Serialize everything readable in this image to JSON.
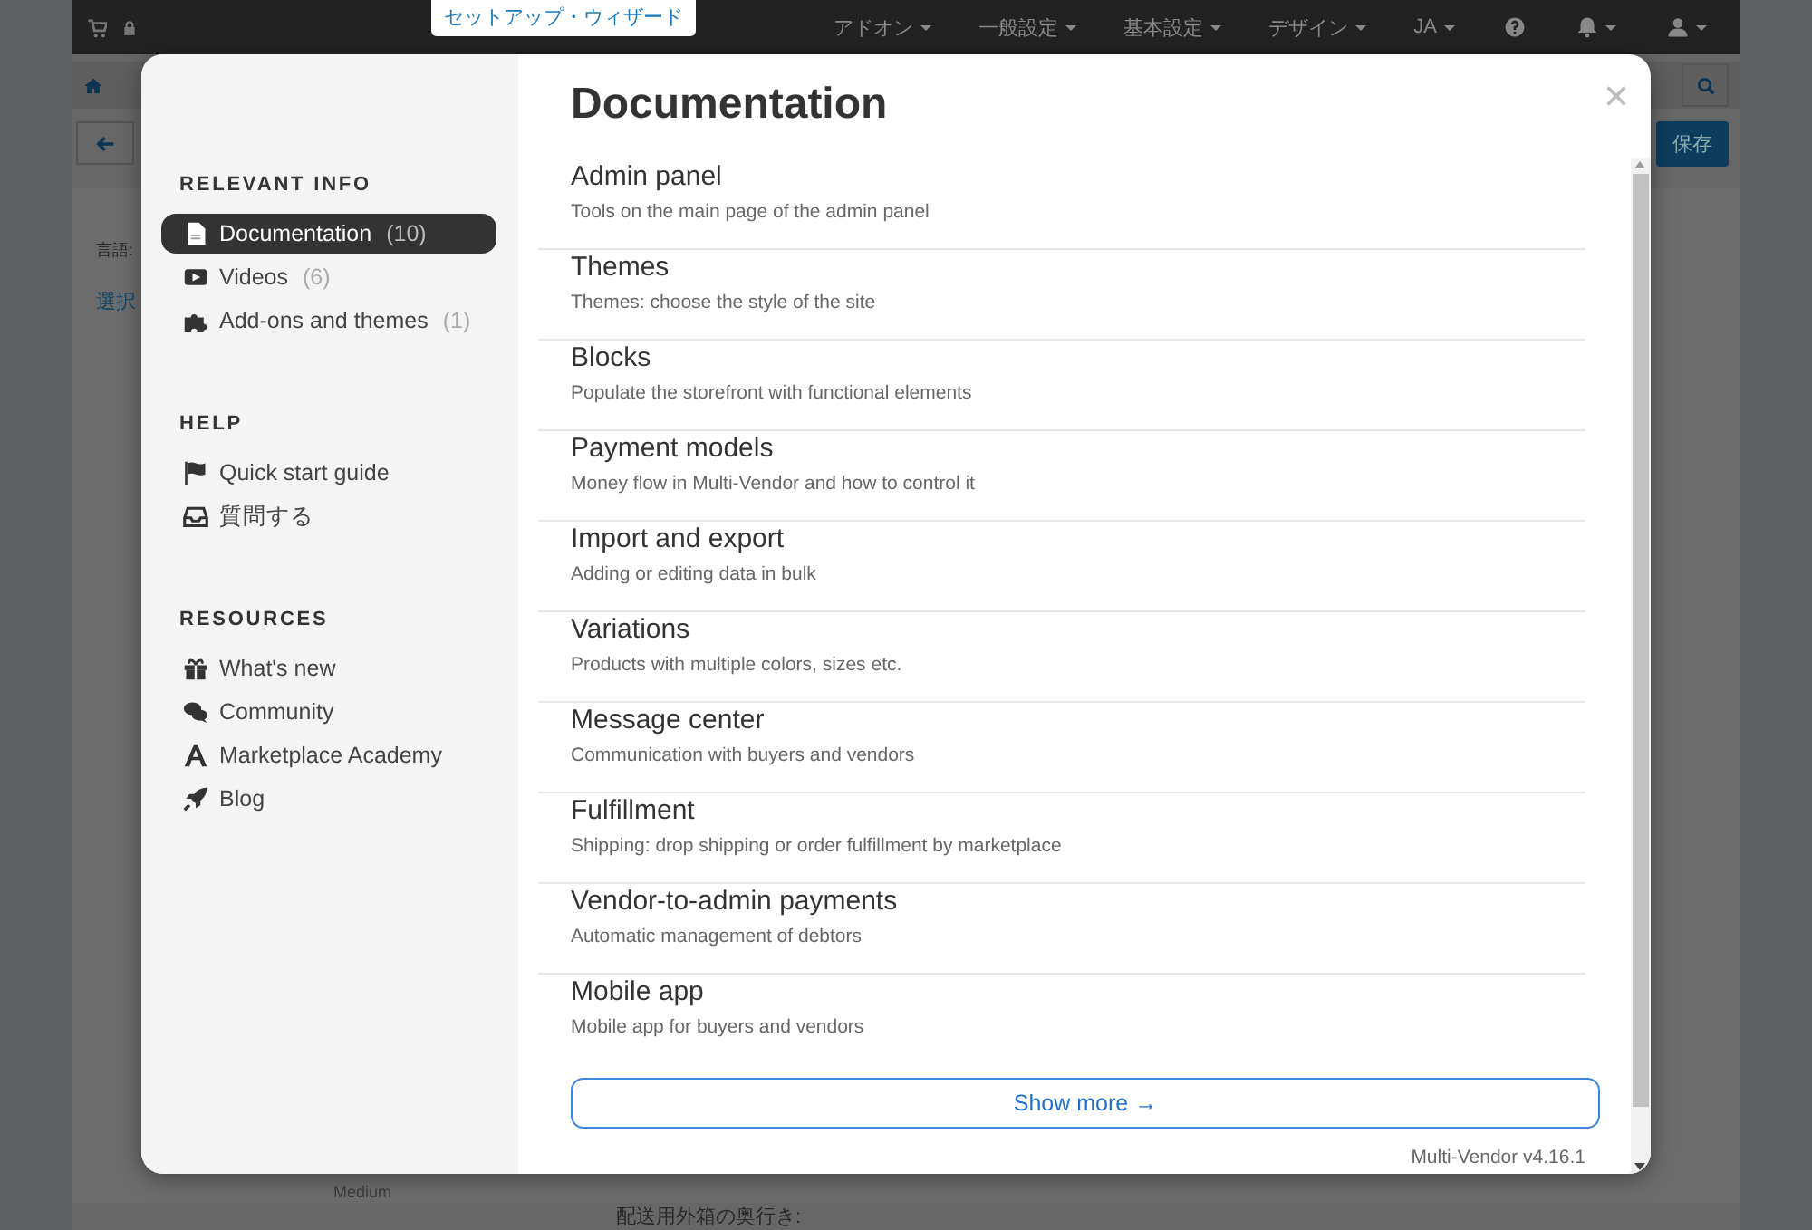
{
  "top_bar": {
    "wizard_link": "セットアップ・ウィザード",
    "menus": [
      {
        "label": "アドオン"
      },
      {
        "label": "一般設定"
      },
      {
        "label": "基本設定"
      },
      {
        "label": "デザイン"
      },
      {
        "label": "JA"
      }
    ]
  },
  "background_page": {
    "save_button": "保存",
    "language_label": "言語:",
    "select_link": "選択",
    "size_text": "Medium",
    "depth_label": "配送用外箱の奥行き:"
  },
  "modal": {
    "close": "×",
    "title": "Documentation",
    "sidebar": [
      {
        "heading": "RELEVANT INFO",
        "items": [
          {
            "label": "Documentation",
            "count": "(10)",
            "selected": true
          },
          {
            "label": "Videos",
            "count": "(6)",
            "selected": false
          },
          {
            "label": "Add-ons and themes",
            "count": "(1)",
            "selected": false
          }
        ]
      },
      {
        "heading": "HELP",
        "items": [
          {
            "label": "Quick start guide",
            "selected": false
          },
          {
            "label": "質問する",
            "selected": false
          }
        ]
      },
      {
        "heading": "RESOURCES",
        "items": [
          {
            "label": "What's new",
            "selected": false
          },
          {
            "label": "Community",
            "selected": false
          },
          {
            "label": "Marketplace Academy",
            "selected": false
          },
          {
            "label": "Blog",
            "selected": false
          }
        ]
      }
    ],
    "articles": [
      {
        "title": "Admin panel",
        "description": "Tools on the main page of the admin panel"
      },
      {
        "title": "Themes",
        "description": "Themes: choose the style of the site"
      },
      {
        "title": "Blocks",
        "description": "Populate the storefront with functional elements"
      },
      {
        "title": "Payment models",
        "description": "Money flow in Multi-Vendor and how to control it"
      },
      {
        "title": "Import and export",
        "description": "Adding or editing data in bulk"
      },
      {
        "title": "Variations",
        "description": "Products with multiple colors, sizes etc."
      },
      {
        "title": "Message center",
        "description": "Communication with buyers and vendors"
      },
      {
        "title": "Fulfillment",
        "description": "Shipping: drop shipping or order fulfillment by marketplace"
      },
      {
        "title": "Vendor-to-admin payments",
        "description": "Automatic management of debtors"
      },
      {
        "title": "Mobile app",
        "description": "Mobile app for buyers and vendors"
      }
    ],
    "show_more": "Show more →",
    "version": "Multi-Vendor v4.16.1"
  }
}
